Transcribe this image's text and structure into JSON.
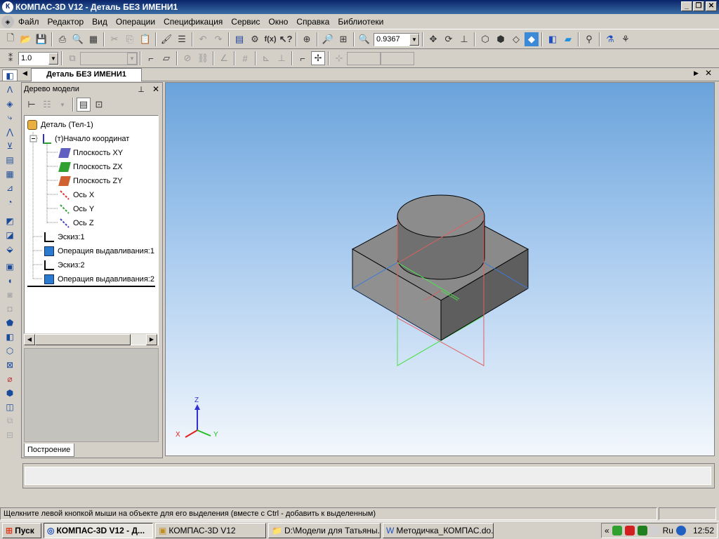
{
  "window": {
    "title": "КОМПАС-3D V12 - Деталь БЕЗ ИМЕНИ1"
  },
  "menu": [
    "Файл",
    "Редактор",
    "Вид",
    "Операции",
    "Спецификация",
    "Сервис",
    "Окно",
    "Справка",
    "Библиотеки"
  ],
  "toolbar1": {
    "zoom_value": "0.9367"
  },
  "toolbar2": {
    "step_value": "1.0"
  },
  "document_tab": {
    "label": "Деталь БЕЗ ИМЕНИ1"
  },
  "tree": {
    "title": "Дерево модели",
    "items": [
      {
        "label": "Деталь (Тел-1)",
        "icon": "part-icon"
      },
      {
        "label": "(т)Начало координат",
        "icon": "origin-icon"
      },
      {
        "label": "Плоскость XY",
        "icon": "plane-xy-icon",
        "color": "#6060c0"
      },
      {
        "label": "Плоскость ZX",
        "icon": "plane-zx-icon",
        "color": "#30a030"
      },
      {
        "label": "Плоскость ZY",
        "icon": "plane-zy-icon",
        "color": "#d06030"
      },
      {
        "label": "Ось X",
        "icon": "axis-x-icon",
        "color": "#e03030"
      },
      {
        "label": "Ось Y",
        "icon": "axis-y-icon",
        "color": "#30a030"
      },
      {
        "label": "Ось Z",
        "icon": "axis-z-icon",
        "color": "#4040c0"
      },
      {
        "label": "Эскиз:1",
        "icon": "sketch-icon"
      },
      {
        "label": "Операция выдавливания:1",
        "icon": "extrude-icon"
      },
      {
        "label": "Эскиз:2",
        "icon": "sketch-icon"
      },
      {
        "label": "Операция выдавливания:2",
        "icon": "extrude-icon"
      }
    ],
    "bottom_tab": "Построение"
  },
  "viewport": {
    "triad": {
      "x_label": "X",
      "y_label": "Y",
      "z_label": "Z"
    }
  },
  "status_bar": {
    "message": "Щелкните левой кнопкой мыши на объекте для его выделения (вместе с Ctrl - добавить к выделенным)"
  },
  "taskbar": {
    "start": "Пуск",
    "tasks": [
      "КОМПАС-3D V12 - Д...",
      "КОМПАС-3D V12",
      "D:\\Модели для Татьяны...",
      "Методичка_КОМПАС.do..."
    ],
    "tray": {
      "lang": "Ru",
      "time": "12:52"
    }
  }
}
